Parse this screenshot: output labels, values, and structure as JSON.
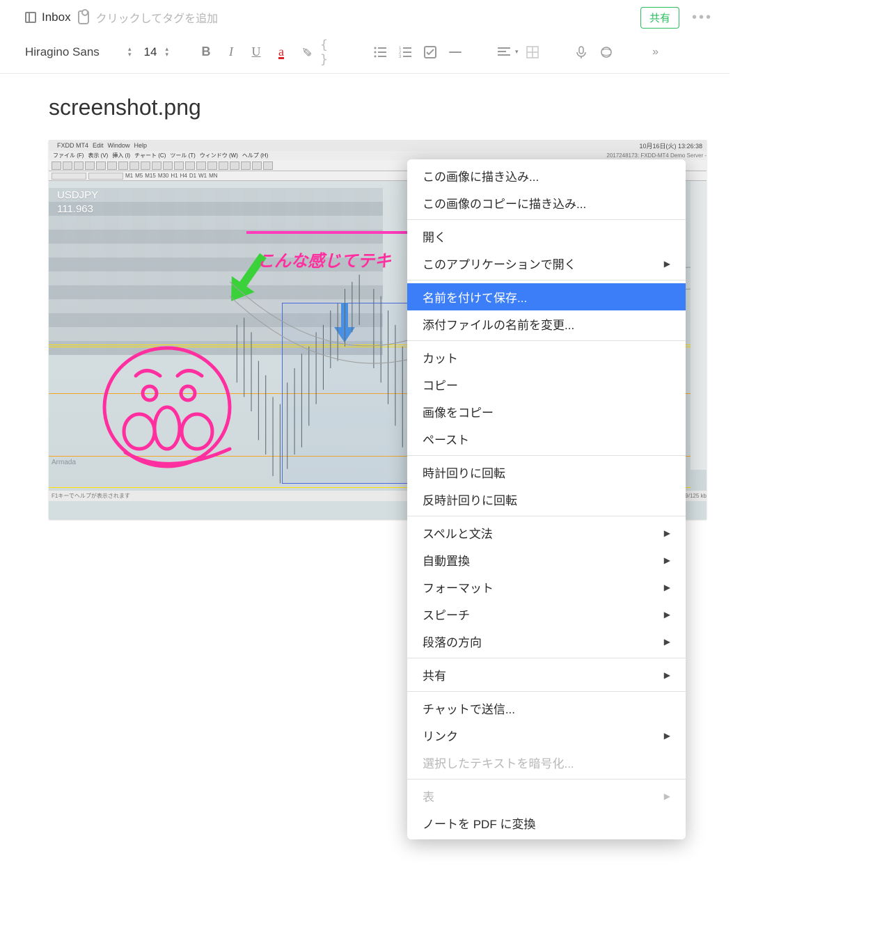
{
  "header": {
    "notebook": "Inbox",
    "tag_placeholder": "クリックしてタグを追加",
    "share": "共有",
    "more": "•••"
  },
  "toolbar": {
    "font": "Hiragino Sans",
    "size": "14",
    "bold": "B",
    "italic": "I",
    "underline": "U",
    "color_a": "a",
    "braces": "{ }",
    "chevrons": "»"
  },
  "note": {
    "filename_title": "screenshot.png"
  },
  "attachment": {
    "mac_menubar": {
      "app": "FXDD MT4",
      "items": [
        "Edit",
        "Window",
        "Help"
      ],
      "time": "10月16日(火)  13:26:38"
    },
    "mt4_title": "2017248173: FXDD-MT4 Demo Server -",
    "mt4_menu": [
      "ファイル (F)",
      "表示 (V)",
      "挿入 (I)",
      "チャート (C)",
      "ツール (T)",
      "ウィンドウ (W)",
      "ヘルプ (H)"
    ],
    "mt4_tb2": [
      "M1",
      "M5",
      "M15",
      "M30",
      "H1",
      "H4",
      "D1",
      "W1",
      "MN"
    ],
    "pair": "USDJPY",
    "price": "111.963",
    "pink_text": "こんな感じてテキ",
    "watermark": "Armada",
    "footer": "F1キーでヘルプが表示されます",
    "status_right": "79/125 kb"
  },
  "context_menu": [
    {
      "type": "item",
      "label": "この画像に描き込み..."
    },
    {
      "type": "item",
      "label": "この画像のコピーに描き込み..."
    },
    {
      "type": "sep"
    },
    {
      "type": "item",
      "label": "開く"
    },
    {
      "type": "item",
      "label": "このアプリケーションで開く",
      "submenu": true
    },
    {
      "type": "sep"
    },
    {
      "type": "item",
      "label": "名前を付けて保存...",
      "highlighted": true
    },
    {
      "type": "item",
      "label": "添付ファイルの名前を変更..."
    },
    {
      "type": "sep"
    },
    {
      "type": "item",
      "label": "カット"
    },
    {
      "type": "item",
      "label": "コピー"
    },
    {
      "type": "item",
      "label": "画像をコピー"
    },
    {
      "type": "item",
      "label": "ペースト"
    },
    {
      "type": "sep"
    },
    {
      "type": "item",
      "label": "時計回りに回転"
    },
    {
      "type": "item",
      "label": "反時計回りに回転"
    },
    {
      "type": "sep"
    },
    {
      "type": "item",
      "label": "スペルと文法",
      "submenu": true
    },
    {
      "type": "item",
      "label": "自動置換",
      "submenu": true
    },
    {
      "type": "item",
      "label": "フォーマット",
      "submenu": true
    },
    {
      "type": "item",
      "label": "スピーチ",
      "submenu": true
    },
    {
      "type": "item",
      "label": "段落の方向",
      "submenu": true
    },
    {
      "type": "sep"
    },
    {
      "type": "item",
      "label": "共有",
      "submenu": true
    },
    {
      "type": "sep"
    },
    {
      "type": "item",
      "label": "チャットで送信..."
    },
    {
      "type": "item",
      "label": "リンク",
      "submenu": true
    },
    {
      "type": "item",
      "label": "選択したテキストを暗号化...",
      "disabled": true
    },
    {
      "type": "sep"
    },
    {
      "type": "item",
      "label": "表",
      "submenu": true,
      "disabled": true
    },
    {
      "type": "item",
      "label": "ノートを PDF に変換"
    }
  ]
}
